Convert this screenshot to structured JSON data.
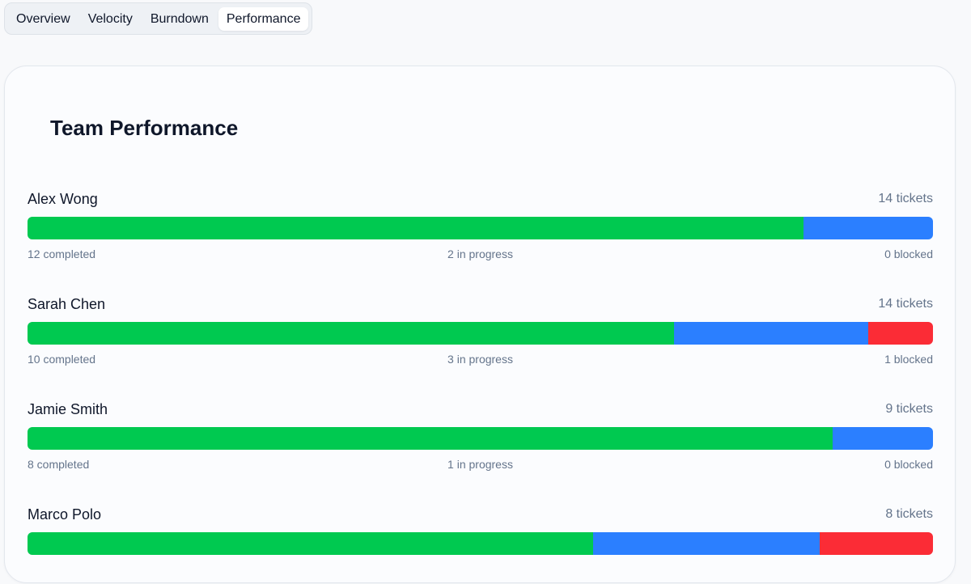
{
  "tabs": [
    {
      "label": "Overview",
      "active": false
    },
    {
      "label": "Velocity",
      "active": false
    },
    {
      "label": "Burndown",
      "active": false
    },
    {
      "label": "Performance",
      "active": true
    }
  ],
  "card": {
    "title": "Team Performance"
  },
  "members": [
    {
      "name": "Alex Wong",
      "tickets": "14 tickets",
      "completed": 12,
      "in_progress": 2,
      "blocked": 0,
      "completed_label": "12 completed",
      "in_progress_label": "2 in progress",
      "blocked_label": "0 blocked"
    },
    {
      "name": "Sarah Chen",
      "tickets": "14 tickets",
      "completed": 10,
      "in_progress": 3,
      "blocked": 1,
      "completed_label": "10 completed",
      "in_progress_label": "3 in progress",
      "blocked_label": "1 blocked"
    },
    {
      "name": "Jamie Smith",
      "tickets": "9 tickets",
      "completed": 8,
      "in_progress": 1,
      "blocked": 0,
      "completed_label": "8 completed",
      "in_progress_label": "1 in progress",
      "blocked_label": "0 blocked"
    },
    {
      "name": "Marco Polo",
      "tickets": "8 tickets",
      "completed": 5,
      "in_progress": 2,
      "blocked": 1,
      "completed_label": "",
      "in_progress_label": "",
      "blocked_label": ""
    }
  ],
  "colors": {
    "completed": "#00c950",
    "in_progress": "#2b7fff",
    "blocked": "#fb2c36"
  }
}
